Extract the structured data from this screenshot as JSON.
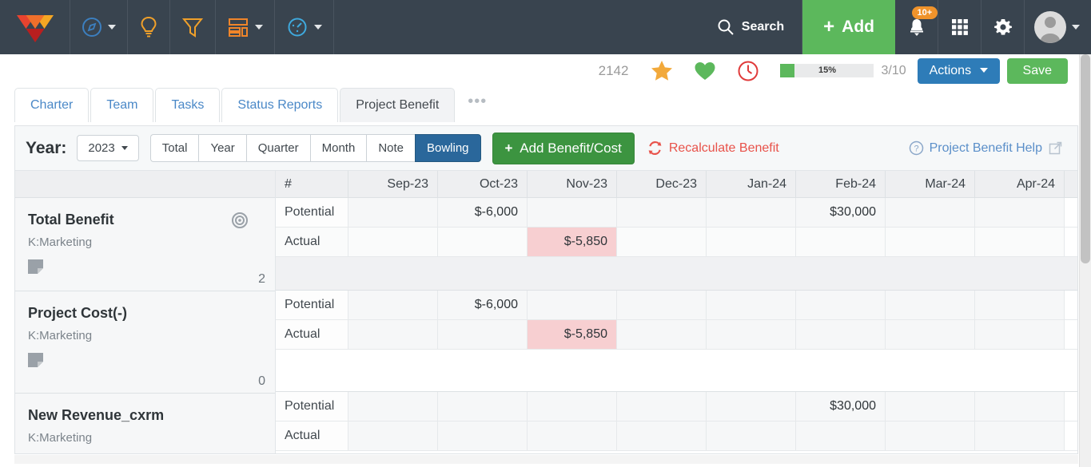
{
  "topnav": {
    "logo_icon": "triangle-logo-icon",
    "items": [
      {
        "icon": "compass-icon",
        "has_caret": true,
        "name": "nav-compass"
      },
      {
        "icon": "lightbulb-icon",
        "has_caret": false,
        "name": "nav-lightbulb"
      },
      {
        "icon": "funnel-icon",
        "has_caret": false,
        "name": "nav-funnel"
      },
      {
        "icon": "layers-icon",
        "has_caret": true,
        "name": "nav-layers"
      },
      {
        "icon": "gauge-icon",
        "has_caret": true,
        "name": "nav-gauge"
      }
    ],
    "search_label": "Search",
    "search_icon": "search-icon",
    "add_label": "Add",
    "add_plus": "+",
    "notification_icon": "notification-bell-icon",
    "notification_badge": "10+",
    "apps_icon": "apps-grid-icon",
    "settings_icon": "gear-icon",
    "avatar_icon": "user-avatar-icon"
  },
  "subheader": {
    "number": "2142",
    "star_icon": "star-icon",
    "heart_icon": "heart-icon",
    "clock_icon": "clock-icon",
    "progress_percent": "15%",
    "progress_value": 15,
    "progress_ratio": "3/10",
    "actions_label": "Actions",
    "save_label": "Save"
  },
  "tabs": {
    "items": [
      {
        "label": "Charter",
        "active": false
      },
      {
        "label": "Team",
        "active": false
      },
      {
        "label": "Tasks",
        "active": false
      },
      {
        "label": "Status Reports",
        "active": false
      },
      {
        "label": "Project Benefit",
        "active": true
      }
    ],
    "more_label": "•••"
  },
  "toolbar": {
    "year_label": "Year:",
    "year_value": "2023",
    "view_buttons": [
      {
        "label": "Total",
        "active": false
      },
      {
        "label": "Year",
        "active": false
      },
      {
        "label": "Quarter",
        "active": false
      },
      {
        "label": "Month",
        "active": false
      },
      {
        "label": "Note",
        "active": false
      },
      {
        "label": "Bowling",
        "active": true
      }
    ],
    "add_benefit_label": "Add Benefit/Cost",
    "add_benefit_plus": "+",
    "recalculate_label": "Recalculate Benefit",
    "recalculate_icon": "refresh-icon",
    "help_label": "Project Benefit Help",
    "help_icon": "question-circle-icon",
    "external_icon": "external-link-icon"
  },
  "grid": {
    "row_header": "#",
    "columns": [
      "Sep-23",
      "Oct-23",
      "Nov-23",
      "Dec-23",
      "Jan-24",
      "Feb-24",
      "Mar-24",
      "Apr-24"
    ],
    "groups": [
      {
        "title": "Total Benefit",
        "subtitle": "K:Marketing",
        "count": "2",
        "has_bullseye": true,
        "bullseye_icon": "target-icon",
        "note_icon": "note-icon",
        "rows": [
          {
            "label": "Potential",
            "values": [
              "",
              "$-6,000",
              "",
              "",
              "",
              "$30,000",
              "",
              ""
            ],
            "highlights": [
              false,
              false,
              false,
              false,
              false,
              false,
              false,
              false
            ]
          },
          {
            "label": "Actual",
            "values": [
              "",
              "",
              "$-5,850",
              "",
              "",
              "",
              "",
              ""
            ],
            "highlights": [
              false,
              false,
              true,
              false,
              false,
              false,
              false,
              false
            ]
          }
        ]
      },
      {
        "title": "Project Cost(-)",
        "subtitle": "K:Marketing",
        "count": "0",
        "has_bullseye": false,
        "note_icon": "note-icon",
        "rows": [
          {
            "label": "Potential",
            "values": [
              "",
              "$-6,000",
              "",
              "",
              "",
              "",
              "",
              ""
            ],
            "highlights": [
              false,
              false,
              false,
              false,
              false,
              false,
              false,
              false
            ]
          },
          {
            "label": "Actual",
            "values": [
              "",
              "",
              "$-5,850",
              "",
              "",
              "",
              "",
              ""
            ],
            "highlights": [
              false,
              false,
              true,
              false,
              false,
              false,
              false,
              false
            ]
          }
        ]
      },
      {
        "title": "New Revenue_cxrm",
        "subtitle": "K:Marketing",
        "count": "",
        "has_bullseye": false,
        "note_icon": "note-icon",
        "rows": [
          {
            "label": "Potential",
            "values": [
              "",
              "",
              "",
              "",
              "",
              "$30,000",
              "",
              ""
            ],
            "highlights": [
              false,
              false,
              false,
              false,
              false,
              false,
              false,
              false
            ]
          },
          {
            "label": "Actual",
            "values": [
              "",
              "",
              "",
              "",
              "",
              "",
              "",
              ""
            ],
            "highlights": [
              false,
              false,
              false,
              false,
              false,
              false,
              false,
              false
            ]
          }
        ]
      }
    ]
  },
  "colors": {
    "nav_bg": "#39444f",
    "add_green": "#5cb85c",
    "actions_blue": "#2e7cb8",
    "active_tab_blue": "#2a679b",
    "recalc_red": "#e8524a",
    "link_blue": "#4a88c7",
    "highlight_pink": "#f7cfd1",
    "badge_orange": "#f0932b"
  }
}
